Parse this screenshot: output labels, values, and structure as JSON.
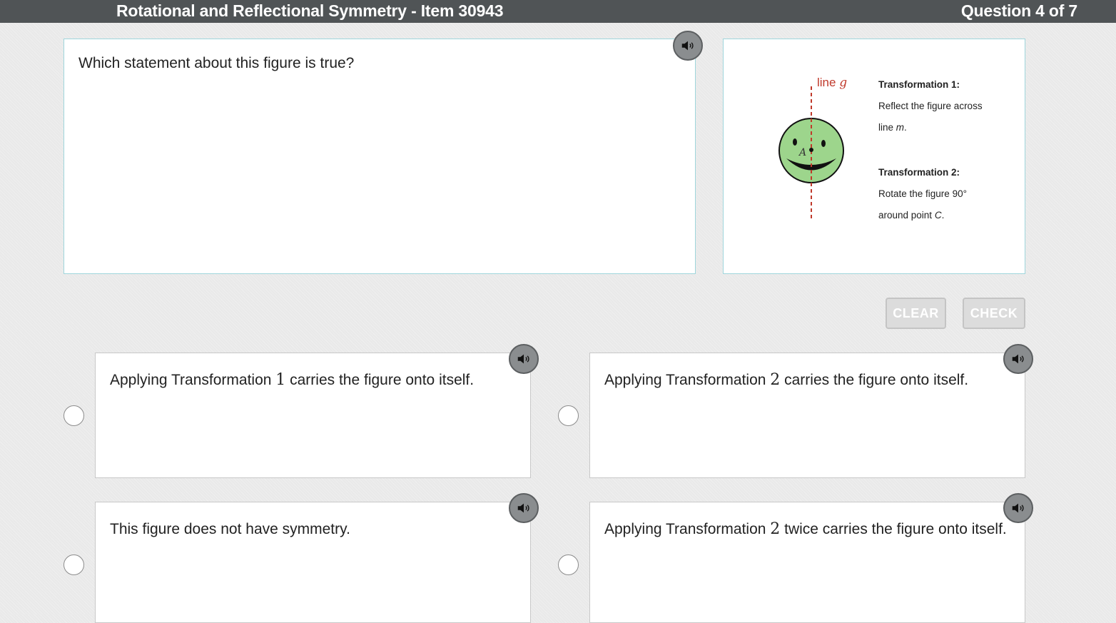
{
  "header": {
    "title": "Rotational and Reflectional Symmetry - Item 30943",
    "question_counter": "Question 4 of 7"
  },
  "question": {
    "prompt": "Which statement about this figure is true?"
  },
  "figure": {
    "line_label": "line",
    "line_var": "g",
    "point_label": "A",
    "transformations": [
      {
        "heading": "Transformation 1:",
        "line1": "Reflect the figure across",
        "line2_prefix": "line ",
        "line2_var": "m",
        "line2_suffix": "."
      },
      {
        "heading": "Transformation 2:",
        "line1": "Rotate the figure 90°",
        "line2_prefix": "around point ",
        "line2_var": "C",
        "line2_suffix": "."
      }
    ],
    "colors": {
      "face_fill": "#9dd58c",
      "line_color": "#c0392b"
    }
  },
  "controls": {
    "clear_label": "CLEAR",
    "check_label": "CHECK"
  },
  "options": [
    {
      "pre": "Applying Transformation ",
      "num": "1",
      "post": " carries the figure onto itself."
    },
    {
      "pre": "Applying Transformation ",
      "num": "2",
      "post": " carries the figure onto itself."
    },
    {
      "pre": "This figure does not have symmetry.",
      "num": "",
      "post": ""
    },
    {
      "pre": "Applying Transformation ",
      "num": "2",
      "post": " twice carries the figure onto itself."
    }
  ],
  "icons": {
    "audio": "speaker-icon"
  }
}
